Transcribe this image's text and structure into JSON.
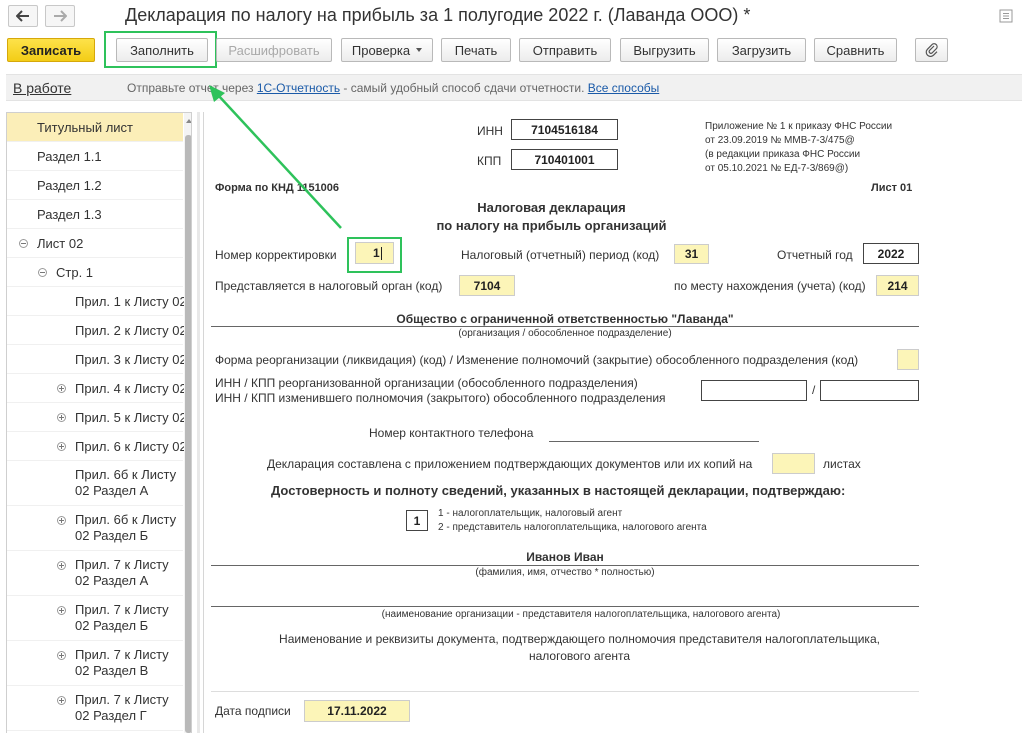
{
  "header": {
    "title": "Декларация по налогу на прибыль за 1 полугодие 2022 г. (Лаванда ООО) *",
    "back_icon": "arrow-left-icon",
    "forward_icon": "arrow-right-icon",
    "menu_icon": "more-menu-icon"
  },
  "toolbar": {
    "save": "Записать",
    "fill": "Заполнить",
    "decode": "Расшифровать",
    "check": "Проверка",
    "print": "Печать",
    "send": "Отправить",
    "export": "Выгрузить",
    "import": "Загрузить",
    "compare": "Сравнить",
    "attach_icon": "paperclip-icon"
  },
  "infobar": {
    "status": "В работе",
    "text_prefix": "Отправьте отчет через ",
    "link1": "1С-Отчетность",
    "text_mid": " - самый удобный способ сдачи отчетности. ",
    "link2": "Все способы"
  },
  "sidebar": {
    "items": [
      {
        "label": "Титульный лист",
        "selected": true
      },
      {
        "label": "Раздел 1.1"
      },
      {
        "label": "Раздел 1.2"
      },
      {
        "label": "Раздел 1.3"
      },
      {
        "label": "Лист 02",
        "expander": "minus"
      },
      {
        "label": "Стр. 1",
        "expander": "minus"
      },
      {
        "label": "Прил. 1 к Листу 02"
      },
      {
        "label": "Прил. 2 к Листу 02"
      },
      {
        "label": "Прил. 3 к Листу 02"
      },
      {
        "label": "Прил. 4 к Листу 02",
        "expander": "plus"
      },
      {
        "label": "Прил. 5 к Листу 02",
        "expander": "plus"
      },
      {
        "label": "Прил. 6 к Листу 02",
        "expander": "plus"
      },
      {
        "label": "Прил. 6б к Листу 02 Раздел А"
      },
      {
        "label": "Прил. 6б к Листу 02 Раздел Б",
        "expander": "plus"
      },
      {
        "label": "Прил. 7 к Листу 02 Раздел А",
        "expander": "plus"
      },
      {
        "label": "Прил. 7 к Листу 02 Раздел Б",
        "expander": "plus"
      },
      {
        "label": "Прил. 7 к Листу 02 Раздел В",
        "expander": "plus"
      },
      {
        "label": "Прил. 7 к Листу 02 Раздел Г",
        "expander": "plus"
      }
    ]
  },
  "form": {
    "inn_label": "ИНН",
    "inn_value": "7104516184",
    "kpp_label": "КПП",
    "kpp_value": "710401001",
    "appendix_note": [
      "Приложение № 1 к приказу ФНС России",
      "от 23.09.2019 № ММВ-7-3/475@",
      "(в редакции приказа ФНС России",
      "от 05.10.2021 № ЕД-7-3/869@)"
    ],
    "form_code": "Форма по КНД 1151006",
    "sheet": "Лист 01",
    "title_line1": "Налоговая декларация",
    "title_line2": "по налогу на прибыль организаций",
    "correction_label": "Номер корректировки",
    "correction_value": "1",
    "period_label": "Налоговый (отчетный) период (код)",
    "period_value": "31",
    "year_label": "Отчетный год",
    "year_value": "2022",
    "tax_office_label": "Представляется в налоговый орган (код)",
    "tax_office_value": "7104",
    "location_label": "по месту нахождения (учета) (код)",
    "location_value": "214",
    "org_name": "Общество с ограниченной ответственностью \"Лаванда\"",
    "org_caption": "(организация / обособленное подразделение)",
    "reorg_label": "Форма реорганизации (ликвидация) (код) / Изменение полномочий (закрытие) обособленного подразделения (код)",
    "reorg_inn_line1": "ИНН / КПП реорганизованной организации (обособленного подразделения)",
    "reorg_inn_line2": "ИНН / КПП изменившего полномочия (закрытого) обособленного подразделения",
    "slash": "/",
    "phone_label": "Номер контактного телефона",
    "attach_label": "Декларация составлена с приложением подтверждающих документов или их копий на",
    "attach_suffix": "листах",
    "confirm_title": "Достоверность и полноту сведений, указанных в настоящей декларации, подтверждаю:",
    "signer_code": "1",
    "signer_opt1": "1 - налогоплательщик, налоговый агент",
    "signer_opt2": "2 - представитель налогоплательщика, налогового агента",
    "signer_name": "Иванов Иван",
    "signer_caption": "(фамилия, имя, отчество *  полностью)",
    "rep_org_caption": "(наименование организации - представителя налогоплательщика, налогового агента)",
    "doc_line1": "Наименование и реквизиты документа, подтверждающего полномочия представителя налогоплательщика,",
    "doc_line2": "налогового агента",
    "sign_date_label": "Дата подписи",
    "sign_date_value": "17.11.2022"
  },
  "colors": {
    "accent_yellow": "#f3cd16",
    "field_yellow": "#fcf5b8",
    "highlight_green": "#2ec25b",
    "link_blue": "#1a5aa8"
  }
}
